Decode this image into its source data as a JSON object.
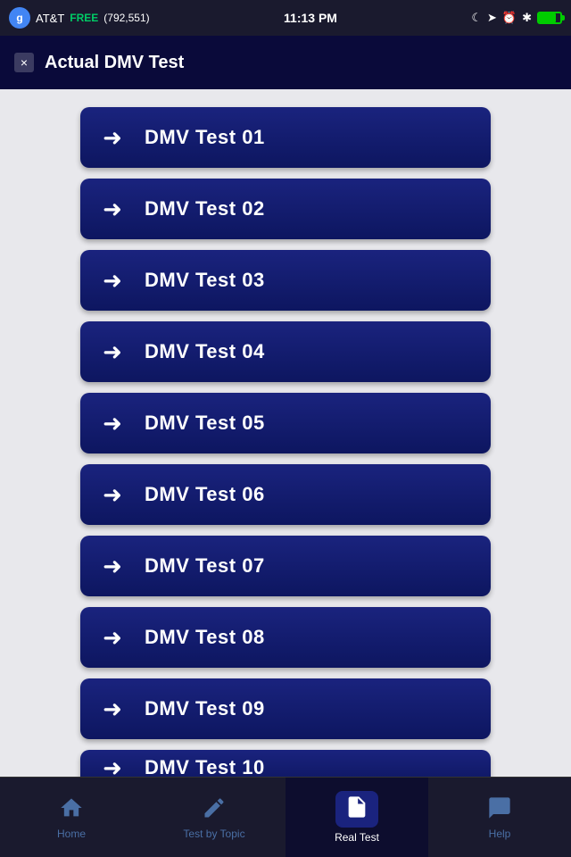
{
  "status_bar": {
    "carrier": "AT&T",
    "app_name": "Google",
    "free_label": "FREE",
    "downloads": "(792,551)",
    "time": "11:13 PM",
    "google_icon_letter": "g"
  },
  "header": {
    "close_label": "×",
    "title": "Actual DMV Test"
  },
  "tests": [
    {
      "label": "DMV Test 01"
    },
    {
      "label": "DMV Test 02"
    },
    {
      "label": "DMV Test 03"
    },
    {
      "label": "DMV Test 04"
    },
    {
      "label": "DMV Test 05"
    },
    {
      "label": "DMV Test 06"
    },
    {
      "label": "DMV Test 07"
    },
    {
      "label": "DMV Test 08"
    },
    {
      "label": "DMV Test 09"
    }
  ],
  "partial_test": {
    "label": "DMV Test 10"
  },
  "tab_bar": {
    "items": [
      {
        "id": "home",
        "label": "Home",
        "icon": "🏠",
        "active": false
      },
      {
        "id": "test-by-topic",
        "label": "Test by Topic",
        "icon": "✏️",
        "active": false
      },
      {
        "id": "real-test",
        "label": "Real Test",
        "icon": "📋",
        "active": true
      },
      {
        "id": "help",
        "label": "Help",
        "icon": "💬",
        "active": false
      }
    ]
  }
}
